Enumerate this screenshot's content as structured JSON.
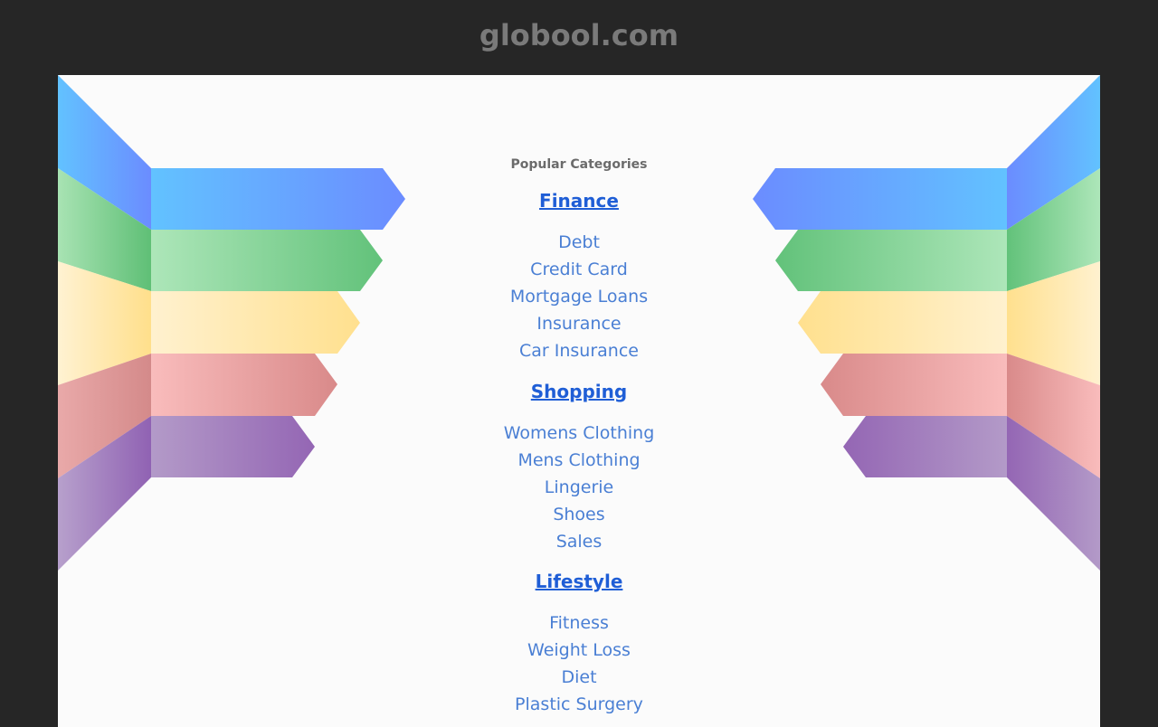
{
  "header": {
    "site_title": "globool.com"
  },
  "main": {
    "popular_heading": "Popular Categories",
    "categories": [
      {
        "label": "Finance",
        "links": [
          "Debt",
          "Credit Card",
          "Mortgage Loans",
          "Insurance",
          "Car Insurance"
        ]
      },
      {
        "label": "Shopping",
        "links": [
          "Womens Clothing",
          "Mens Clothing",
          "Lingerie",
          "Shoes",
          "Sales"
        ]
      },
      {
        "label": "Lifestyle",
        "links": [
          "Fitness",
          "Weight Loss",
          "Diet",
          "Plastic Surgery"
        ]
      }
    ]
  },
  "colors": {
    "page_background": "#262626",
    "panel_background": "#fbfbfb",
    "category_link": "#1f5ed6",
    "sub_link": "#4a7fd4",
    "ribbon_blue": "#5fbfff",
    "ribbon_green": "#66c27a",
    "ribbon_yellow": "#ffe39a",
    "ribbon_red": "#e08e8e",
    "ribbon_purple": "#9a72b8"
  }
}
